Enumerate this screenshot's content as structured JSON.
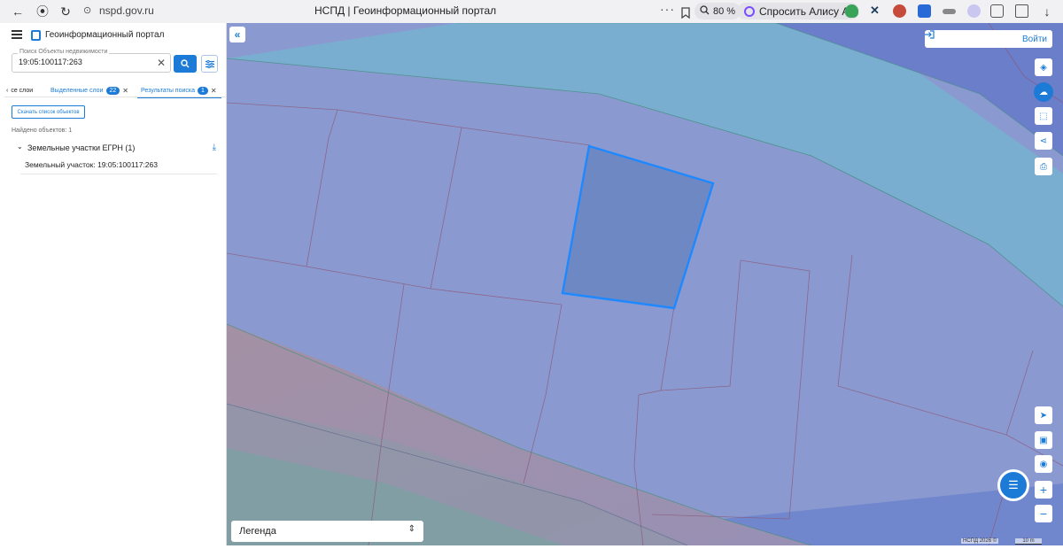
{
  "browser": {
    "url": "nspd.gov.ru",
    "tab_title": "НСПД | Геоинформационный портал",
    "more": "···",
    "zoom": "80 %",
    "alice_label": "Спросить Алису AI"
  },
  "sidebar": {
    "title": "Геоинформационный портал",
    "search": {
      "label": "Поиск Объекты недвижимости",
      "value": "19:05:100117:263"
    },
    "tabs": [
      {
        "label": "се слои"
      },
      {
        "label": "Выделенные слои",
        "count": "22"
      },
      {
        "label": "Результаты поиска",
        "count": "1"
      }
    ],
    "download_list_label": "Скачать список объектов",
    "found_count": "Найдено объектов: 1",
    "group": {
      "label": "Земельные участки ЕГРН (1)",
      "items": [
        {
          "label": "Земельный участок: 19:05:100117:263"
        }
      ]
    }
  },
  "map": {
    "login_label": "Войти",
    "legend_label": "Легенда",
    "copyright": "НСПД 2026 ©",
    "scale_label": "10 m"
  },
  "colors": {
    "accent": "#1b7bd6",
    "map_base": "#8a9ad0",
    "river": "#7aaed0",
    "selected_parcel": "#6e88c4",
    "parcel_outline": "#1e88ff"
  }
}
